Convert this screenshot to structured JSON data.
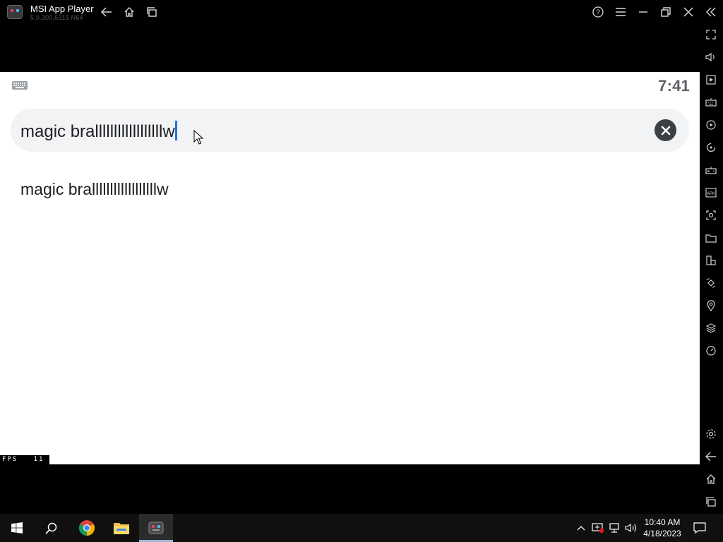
{
  "titlebar": {
    "app_title": "MSI App Player",
    "version": "5.9.300.6315 N64",
    "icons": [
      "back-icon",
      "home-icon",
      "recent-apps-icon",
      "help-icon",
      "menu-icon",
      "minimize-icon",
      "restore-icon",
      "close-icon",
      "collapse-sidebar-icon"
    ]
  },
  "sidebar": {
    "icons": [
      "fullscreen-icon",
      "volume-icon",
      "media-manager-icon",
      "keyboard-controls-icon",
      "macro-icon",
      "sync-icon",
      "gamepad-icon",
      "install-apk-icon",
      "screenshot-icon",
      "folder-icon",
      "multi-instance-icon",
      "rotate-icon",
      "location-icon",
      "layers-icon",
      "eco-mode-icon",
      "settings-icon",
      "android-back-icon",
      "android-home-icon",
      "android-recents-icon"
    ]
  },
  "android": {
    "clock": "7:41",
    "search": {
      "value": "magic brallllllllllllllllllw"
    },
    "suggestions": [
      "magic brallllllllllllllllllw"
    ],
    "fps_label": "FPS",
    "fps_value": "11"
  },
  "taskbar": {
    "time": "10:40 AM",
    "date": "4/18/2023",
    "apps": [
      "windows-start-icon",
      "search-icon",
      "chrome-icon",
      "file-explorer-icon",
      "msi-app-player-icon"
    ]
  },
  "colors": {
    "accent": "#1a73e8",
    "search_bg": "#f1f3f4",
    "clear_btn": "#3c4043"
  }
}
